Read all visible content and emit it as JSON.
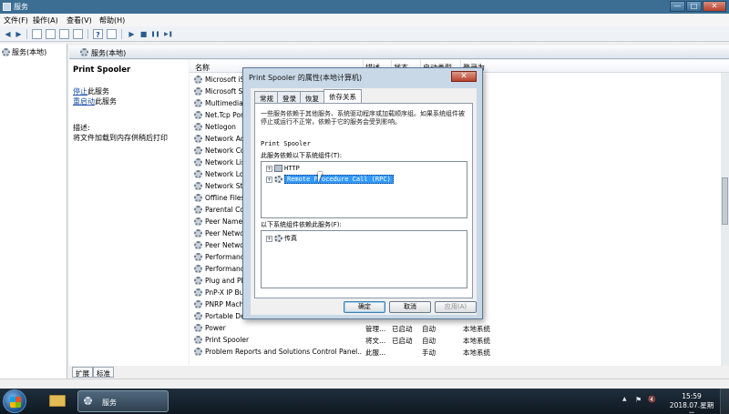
{
  "window": {
    "title": "服务",
    "controls": {
      "minimize": "—",
      "maximize": "□",
      "close": "✕"
    }
  },
  "menubar": {
    "items": [
      "文件(F)",
      "操作(A)",
      "查看(V)",
      "帮助(H)"
    ]
  },
  "toolbar": {
    "icons": [
      "back-arrow-icon",
      "forward-arrow-icon",
      "show-hide-tree-icon",
      "list-icon",
      "refresh-icon",
      "export-icon",
      "help-icon",
      "properties-icon",
      "start-icon",
      "stop-icon",
      "pause-icon",
      "restart-icon"
    ],
    "glyphs": {
      "back": "◀",
      "forward": "▶",
      "play": "▶",
      "stop": "■",
      "pause": "❚❚",
      "restart": "▶❚",
      "help": "?"
    }
  },
  "left_tree": {
    "label": "服务(本地)"
  },
  "right_header": {
    "label": "服务(本地)"
  },
  "description": {
    "service_title": "Print Spooler",
    "stop_link": "停止",
    "stop_suffix": "此服务",
    "restart_link": "重启动",
    "restart_suffix": "此服务",
    "desc_label": "描述:",
    "desc_text": "将文件加载到内存供稍后打印"
  },
  "list": {
    "columns": {
      "name": "名称",
      "description": "描述",
      "status": "状态",
      "startup": "启动类型",
      "logon": "登录为"
    },
    "rows": [
      {
        "name": "Microsoft iS",
        "description": "",
        "status": "",
        "startup": "",
        "logon": ""
      },
      {
        "name": "Microsoft S",
        "description": "",
        "status": "",
        "startup": "",
        "logon": ""
      },
      {
        "name": "Multimedia",
        "description": "",
        "status": "",
        "startup": "",
        "logon": ""
      },
      {
        "name": "Net.Tcp Por",
        "description": "",
        "status": "",
        "startup": "",
        "logon": ""
      },
      {
        "name": "Netlogon",
        "description": "",
        "status": "",
        "startup": "",
        "logon": ""
      },
      {
        "name": "Network Ac",
        "description": "",
        "status": "",
        "startup": "",
        "logon": ""
      },
      {
        "name": "Network Co",
        "description": "",
        "status": "",
        "startup": "",
        "logon": ""
      },
      {
        "name": "Network Lis",
        "description": "",
        "status": "",
        "startup": "",
        "logon": ""
      },
      {
        "name": "Network Lo",
        "description": "",
        "status": "",
        "startup": "",
        "logon": ""
      },
      {
        "name": "Network Sto",
        "description": "",
        "status": "",
        "startup": "",
        "logon": ""
      },
      {
        "name": "Offline Files",
        "description": "",
        "status": "",
        "startup": "",
        "logon": ""
      },
      {
        "name": "Parental Co",
        "description": "",
        "status": "",
        "startup": "",
        "logon": ""
      },
      {
        "name": "Peer Name",
        "description": "",
        "status": "",
        "startup": "",
        "logon": ""
      },
      {
        "name": "Peer Netwo",
        "description": "",
        "status": "",
        "startup": "",
        "logon": ""
      },
      {
        "name": "Peer Netwo",
        "description": "",
        "status": "",
        "startup": "",
        "logon": ""
      },
      {
        "name": "Performanc",
        "description": "",
        "status": "",
        "startup": "",
        "logon": ""
      },
      {
        "name": "Performanc",
        "description": "",
        "status": "",
        "startup": "",
        "logon": ""
      },
      {
        "name": "Plug and Pla",
        "description": "",
        "status": "",
        "startup": "",
        "logon": ""
      },
      {
        "name": "PnP-X IP Bu",
        "description": "",
        "status": "",
        "startup": "",
        "logon": ""
      },
      {
        "name": "PNRP Mach",
        "description": "",
        "status": "",
        "startup": "",
        "logon": ""
      },
      {
        "name": "Portable Device Enumerator Service",
        "description": "",
        "status": "",
        "startup": "",
        "logon": ""
      },
      {
        "name": "Power",
        "description": "管理...",
        "status": "已启动",
        "startup": "自动",
        "logon": "本地系统"
      },
      {
        "name": "Print Spooler",
        "description": "将文...",
        "status": "已启动",
        "startup": "自动",
        "logon": "本地系统"
      },
      {
        "name": "Problem Reports and Solutions Control Panel...",
        "description": "此服...",
        "status": "",
        "startup": "手动",
        "logon": "本地系统"
      }
    ]
  },
  "bottom_tabs": [
    "扩展",
    "标准"
  ],
  "dialog": {
    "title": "Print Spooler 的属性(本地计算机)",
    "close": "✕",
    "tabs": [
      "常规",
      "登录",
      "恢复",
      "依存关系"
    ],
    "active_tab": "依存关系",
    "description": "一些服务依赖于其他服务、系统驱动程序或加载顺序组。如果系统组件被停止或运行不正常，依赖于它的服务会受到影响。",
    "service_name": "Print Spooler",
    "depends_on_label": "此服务依赖以下系统组件(T):",
    "depends_on": [
      "HTTP",
      "Remote Procedure Call (RPC)"
    ],
    "dependents_label": "以下系统组件依赖此服务(F):",
    "dependents": [
      "传真"
    ],
    "buttons": {
      "ok": "确定",
      "cancel": "取消",
      "apply": "应用(A)"
    },
    "expander": "+"
  },
  "taskbar": {
    "active_item": "服务",
    "tray_glyphs": {
      "up": "▲",
      "flag": "⚑",
      "speaker": "🔇"
    },
    "time": "15:59",
    "date": "2018.07.星期二"
  }
}
